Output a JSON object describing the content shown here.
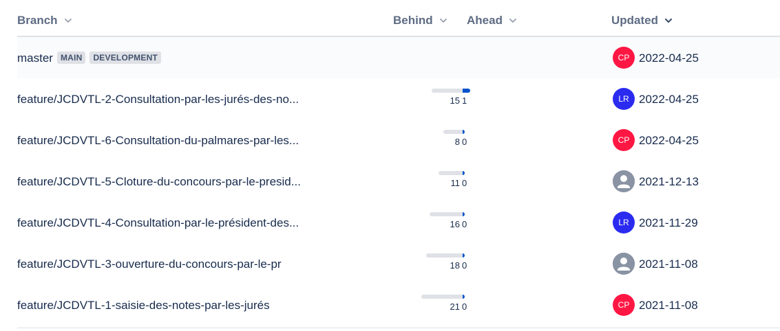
{
  "columns": {
    "branch": "Branch",
    "behind": "Behind",
    "ahead": "Ahead",
    "updated": "Updated"
  },
  "rows": [
    {
      "name": "master",
      "lozenges": [
        "MAIN",
        "DEVELOPMENT"
      ],
      "behind": null,
      "ahead": null,
      "author": "CP",
      "author_type": "cp",
      "date": "2022-04-25"
    },
    {
      "name": "feature/JCDVTL-2-Consultation-par-les-jurés-des-no...",
      "behind": "15",
      "ahead": "1",
      "author": "LR",
      "author_type": "lr",
      "date": "2022-04-25"
    },
    {
      "name": "feature/JCDVTL-6-Consultation-du-palmares-par-les...",
      "behind": "8",
      "ahead": "0",
      "author": "CP",
      "author_type": "cp",
      "date": "2022-04-25"
    },
    {
      "name": "feature/JCDVTL-5-Cloture-du-concours-par-le-presid...",
      "behind": "11",
      "ahead": "0",
      "author": "",
      "author_type": "default",
      "date": "2021-12-13"
    },
    {
      "name": "feature/JCDVTL-4-Consultation-par-le-président-des...",
      "behind": "16",
      "ahead": "0",
      "author": "LR",
      "author_type": "lr",
      "date": "2021-11-29"
    },
    {
      "name": "feature/JCDVTL-3-ouverture-du-concours-par-le-pr",
      "behind": "18",
      "ahead": "0",
      "author": "",
      "author_type": "default",
      "date": "2021-11-08"
    },
    {
      "name": "feature/JCDVTL-1-saisie-des-notes-par-les-jurés",
      "behind": "21",
      "ahead": "0",
      "author": "CP",
      "author_type": "cp",
      "date": "2021-11-08"
    }
  ],
  "colors": {
    "ahead_bar": "#0052cc",
    "behind_bar": "#dfe1e6",
    "avatar_cp": "#ff1744",
    "avatar_lr": "#2b2bf0",
    "avatar_default": "#8993a4"
  }
}
